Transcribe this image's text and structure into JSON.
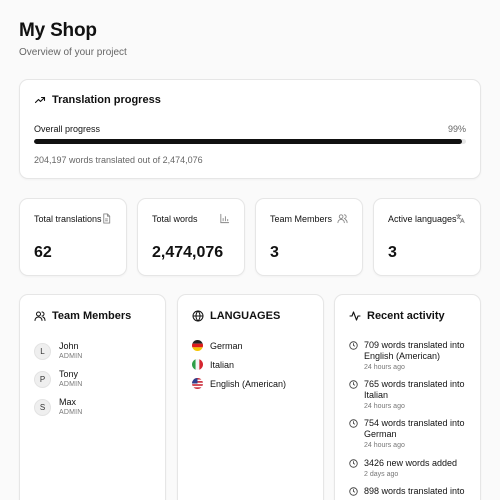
{
  "header": {
    "title": "My Shop",
    "subtitle": "Overview of your project"
  },
  "progress": {
    "title": "Translation progress",
    "label": "Overall progress",
    "percent_text": "99%",
    "fraction": 0.99,
    "note": "204,197 words translated out of 2,474,076",
    "icon": "trending-up-icon"
  },
  "stats": [
    {
      "label": "Total translations",
      "value": "62",
      "icon": "document-icon"
    },
    {
      "label": "Total words",
      "value": "2,474,076",
      "icon": "bar-chart-icon"
    },
    {
      "label": "Team Members",
      "value": "3",
      "icon": "users-icon"
    },
    {
      "label": "Active languages",
      "value": "3",
      "icon": "translate-icon"
    }
  ],
  "team": {
    "title": "Team Members",
    "icon": "users-icon",
    "members": [
      {
        "initial": "L",
        "name": "John",
        "role": "ADMIN"
      },
      {
        "initial": "P",
        "name": "Tony",
        "role": "ADMIN"
      },
      {
        "initial": "S",
        "name": "Max",
        "role": "ADMIN"
      }
    ]
  },
  "languages": {
    "title": "LANGUAGES",
    "icon": "globe-icon",
    "items": [
      {
        "name": "German",
        "flag": "flag-de-icon"
      },
      {
        "name": "Italian",
        "flag": "flag-it-icon"
      },
      {
        "name": "English (American)",
        "flag": "flag-us-icon"
      }
    ]
  },
  "activity": {
    "title": "Recent activity",
    "icon": "activity-icon",
    "items": [
      {
        "text": "709 words translated into English (American)",
        "time": "24 hours ago"
      },
      {
        "text": "765 words translated into Italian",
        "time": "24 hours ago"
      },
      {
        "text": "754 words translated into German",
        "time": "24 hours ago"
      },
      {
        "text": "3426 new words added",
        "time": "2 days ago"
      },
      {
        "text": "898 words translated into",
        "time": ""
      }
    ]
  }
}
